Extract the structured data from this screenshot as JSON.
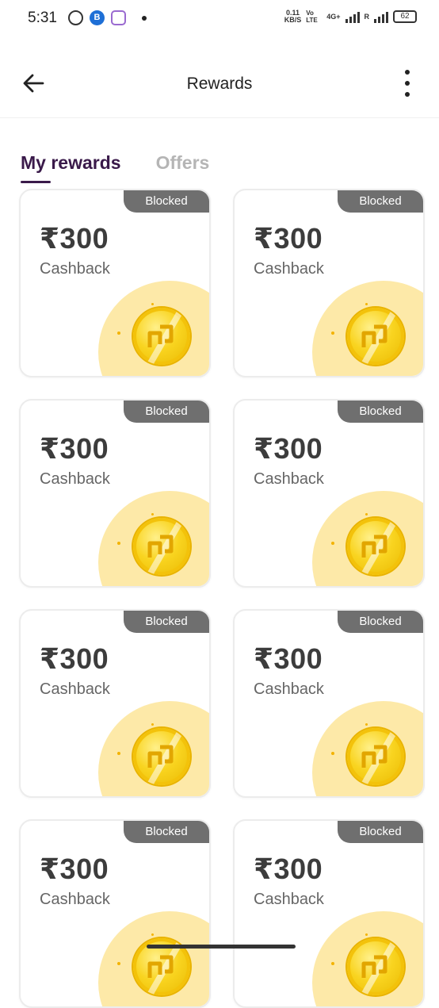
{
  "status_bar": {
    "time": "5:31",
    "icons": [
      "whatsapp-icon",
      "b-app-icon",
      "timer-app-icon"
    ],
    "net_speed": "0.11",
    "net_unit": "KB/S",
    "volte": "Vo LTE",
    "network": "4G+",
    "roaming": "R",
    "battery": "62"
  },
  "app_bar": {
    "title": "Rewards"
  },
  "tabs": [
    {
      "label": "My rewards",
      "active": true
    },
    {
      "label": "Offers",
      "active": false
    }
  ],
  "cards": [
    {
      "badge": "Blocked",
      "amount": "₹300",
      "label": "Cashback"
    },
    {
      "badge": "Blocked",
      "amount": "₹300",
      "label": "Cashback"
    },
    {
      "badge": "Blocked",
      "amount": "₹300",
      "label": "Cashback"
    },
    {
      "badge": "Blocked",
      "amount": "₹300",
      "label": "Cashback"
    },
    {
      "badge": "Blocked",
      "amount": "₹300",
      "label": "Cashback"
    },
    {
      "badge": "Blocked",
      "amount": "₹300",
      "label": "Cashback"
    },
    {
      "badge": "Blocked",
      "amount": "₹300",
      "label": "Cashback"
    },
    {
      "badge": "Blocked",
      "amount": "₹300",
      "label": "Cashback"
    }
  ],
  "colors": {
    "accent": "#3a1a4a",
    "badge_bg": "#6f6f6f",
    "coin": "#f9d420"
  }
}
